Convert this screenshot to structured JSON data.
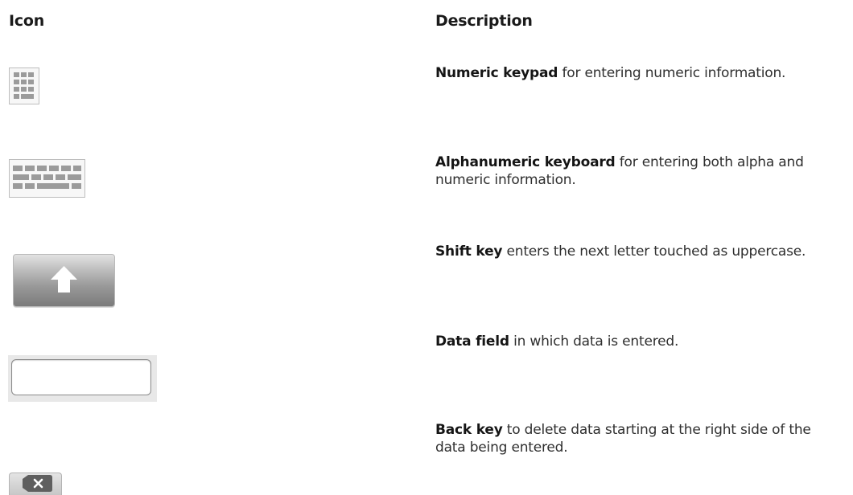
{
  "header": {
    "icon_label": "Icon",
    "description_label": "Description"
  },
  "rows": [
    {
      "icon": "numeric-keypad-icon",
      "term": "Numeric keypad",
      "text": " for entering numeric information."
    },
    {
      "icon": "alphanumeric-keyboard-icon",
      "term": "Alphanumeric keyboard",
      "text": " for entering both alpha and numeric information."
    },
    {
      "icon": "shift-key-icon",
      "term": "Shift key",
      "text": " enters the next letter touched as uppercase."
    },
    {
      "icon": "data-field-icon",
      "term": "Data field",
      "text": " in which data is entered."
    },
    {
      "icon": "back-key-icon",
      "term": "Back key",
      "text": " to delete data starting at the right side of the data being entered."
    }
  ],
  "colors": {
    "key_gray": "#9b9b9b",
    "text": "#2f2f2f",
    "heading": "#1a1a1a"
  }
}
